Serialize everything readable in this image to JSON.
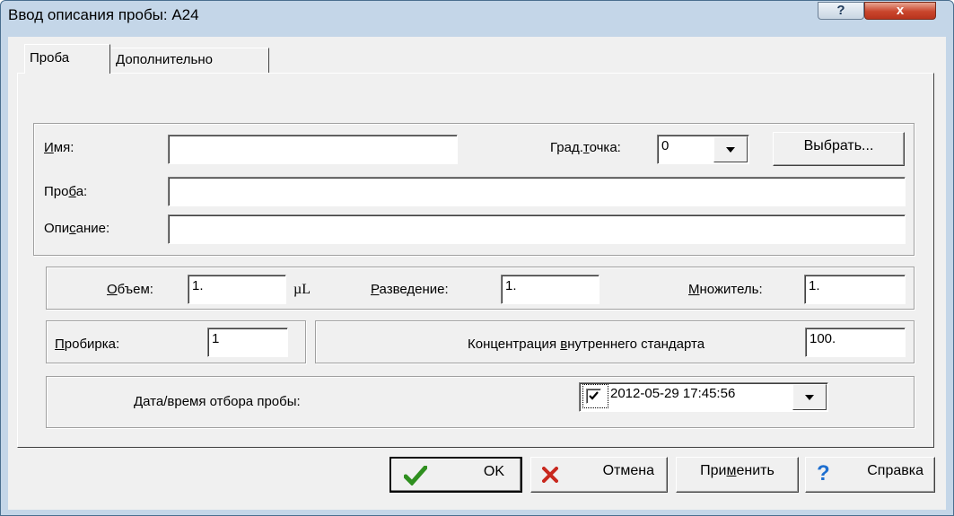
{
  "window": {
    "title": "Ввод описания пробы: A24",
    "help_glyph": "?",
    "close_glyph": "x"
  },
  "tabs": [
    {
      "label": "Проба"
    },
    {
      "label": "Дополнительно"
    }
  ],
  "fields": {
    "name": {
      "label_pre": "",
      "label_key": "И",
      "label_post": "мя:",
      "value": ""
    },
    "grad_point": {
      "label_pre": "Град.",
      "label_key": "т",
      "label_post": "очка:",
      "value": "0"
    },
    "choose_button": "Выбрать...",
    "sample": {
      "label_pre": "Про",
      "label_key": "б",
      "label_post": "а:",
      "value": ""
    },
    "description": {
      "label_pre": "Опи",
      "label_key": "с",
      "label_post": "ание:",
      "value": ""
    },
    "volume": {
      "label_pre": "",
      "label_key": "О",
      "label_post": "бъем:",
      "value": "1.",
      "unit": "µL"
    },
    "dilution": {
      "label_pre": "",
      "label_key": "Р",
      "label_post": "азведение:",
      "value": "1."
    },
    "multiplier": {
      "label_pre": "",
      "label_key": "М",
      "label_post": "ножитель:",
      "value": "1."
    },
    "tube": {
      "label_pre": "",
      "label_key": "П",
      "label_post": "робирка:",
      "value": "1"
    },
    "internal_standard": {
      "label_pre": "Концентрация ",
      "label_key": "в",
      "label_post": "нутреннего стандарта",
      "value": "100."
    },
    "sampling_datetime": {
      "label_pre": "",
      "label_key": "Д",
      "label_post": "ата/время отбора пробы:",
      "value": "2012-05-29 17:45:56",
      "checked": true
    }
  },
  "buttons": {
    "ok": "OK",
    "cancel": "Отмена",
    "apply_pre": "При",
    "apply_key": "м",
    "apply_post": "енить",
    "help": "Справка"
  },
  "colors": {
    "ok_check": "#2f8f1f",
    "cancel_x": "#c8281e",
    "help_q": "#1e6fd0",
    "close_button": "#c9452c"
  }
}
